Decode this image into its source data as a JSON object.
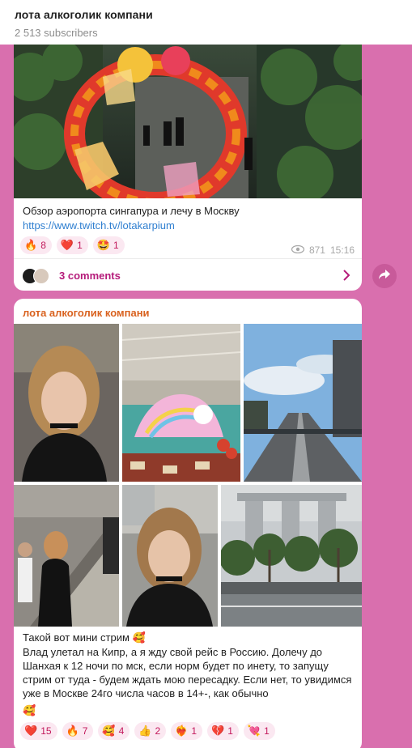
{
  "header": {
    "title": "лота алкоголик компани",
    "subscribers": "2 513 subscribers"
  },
  "post1": {
    "caption": "Обзор аэропорта сингапура и лечу в Москву",
    "link": "https://www.twitch.tv/lotakarpium",
    "reactions": [
      {
        "emoji": "🔥",
        "count": "8"
      },
      {
        "emoji": "❤️",
        "count": "1"
      },
      {
        "emoji": "🤩",
        "count": "1"
      }
    ],
    "views": "871",
    "time": "15:16",
    "comments_label": "3 comments"
  },
  "post2": {
    "author": "лота алкоголик компани",
    "caption_line1": "Такой вот мини стрим 🥰",
    "caption_body": "Влад улетал на Кипр, а я жду свой рейс в Россию. Долечу до Шанхая к 12 ночи по мск, если норм будет по инету, то запущу стрим от туда - будем ждать мою пересадку. Если нет, то увидимся уже в Москве 24го числа часов в 14+-, как обычно",
    "caption_end": "🥰",
    "reactions": [
      {
        "emoji": "❤️",
        "count": "15"
      },
      {
        "emoji": "🔥",
        "count": "7"
      },
      {
        "emoji": "🥰",
        "count": "4"
      },
      {
        "emoji": "👍",
        "count": "2"
      },
      {
        "emoji": "❤️‍🔥",
        "count": "1"
      },
      {
        "emoji": "💔",
        "count": "1"
      },
      {
        "emoji": "💘",
        "count": "1"
      }
    ]
  },
  "colors": {
    "background": "#d96fae",
    "accent": "#b51b7a",
    "link": "#2f7fd0",
    "author": "#d9621f"
  }
}
